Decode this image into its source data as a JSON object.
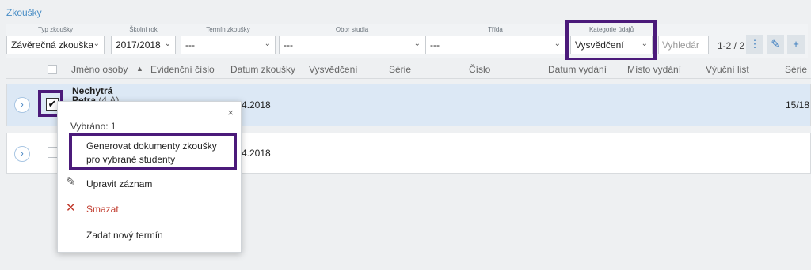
{
  "section_title": "Zkoušky",
  "filters": {
    "typ_label": "Typ zkoušky",
    "typ_value": "Závěrečná zkouška",
    "rok_label": "Školní rok",
    "rok_value": "2017/2018",
    "termin_label": "Termín zkoušky",
    "termin_value": "---",
    "obor_label": "Obor studia",
    "obor_value": "---",
    "trida_label": "Třída",
    "trida_value": "---",
    "kategorie_label": "Kategorie údajů",
    "kategorie_value": "Vysvědčení",
    "search_placeholder": "Vyhledár",
    "pager": "1-2 / 2"
  },
  "columns": [
    "Jméno osoby",
    "Evidenční číslo",
    "Datum zkoušky",
    "Vysvědčení",
    "Série",
    "Číslo",
    "Datum vydání",
    "Místo vydání",
    "Výuční list",
    "Série"
  ],
  "rows": [
    {
      "name": "Nechytrá Petra",
      "name_line1": "Nechytrá",
      "name_line2": "Petra",
      "class": "(4.A)",
      "date_fragment": "4.2018",
      "serie2": "15/18",
      "checked": true
    },
    {
      "date_fragment": "4.2018",
      "checked": false
    }
  ],
  "popup": {
    "close": "×",
    "selected": "Vybráno: 1",
    "items": [
      {
        "label": "Generovat dokumenty zkoušky pro vybrané studenty"
      },
      {
        "label": "Upravit záznam"
      },
      {
        "label": "Smazat"
      },
      {
        "label": "Zadat nový termín"
      }
    ]
  },
  "colors": {
    "accent": "#3b7dbf",
    "highlight": "#4b1a7a",
    "selected_row": "#dce8f5",
    "danger": "#c0392b"
  }
}
